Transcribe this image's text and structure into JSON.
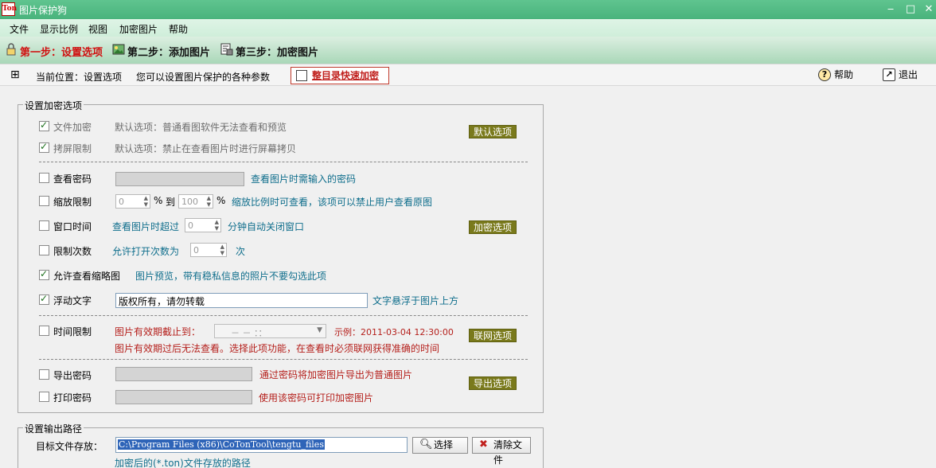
{
  "window": {
    "title": "图片保护狗",
    "icon_text": "Ton",
    "min": "‒",
    "max": "□",
    "close": "✕"
  },
  "menu": [
    "文件",
    "显示比例",
    "视图",
    "加密图片",
    "帮助"
  ],
  "steps": [
    {
      "label": "第一步：设置选项",
      "active": true
    },
    {
      "label": "第二步：添加图片",
      "active": false
    },
    {
      "label": "第三步：加密图片",
      "active": false
    }
  ],
  "location": {
    "expand": "⊞",
    "current": "当前位置：设置选项",
    "desc": "您可以设置图片保护的各种参数",
    "quick_encrypt": "整目录快速加密",
    "help": "帮助",
    "exit": "退出"
  },
  "encrypt_group": {
    "legend": "设置加密选项",
    "default_section": {
      "button": "默认选项",
      "items": [
        {
          "label": "文件加密",
          "checked": true,
          "desc": "默认选项：普通看图软件无法查看和预览"
        },
        {
          "label": "拷屏限制",
          "checked": true,
          "desc": "默认选项：禁止在查看图片时进行屏幕拷贝"
        }
      ]
    },
    "encrypt_section": {
      "button": "加密选项",
      "view_password": {
        "label": "查看密码",
        "checked": false,
        "desc": "查看图片时需输入的密码"
      },
      "zoom_limit": {
        "label": "缩放限制",
        "checked": false,
        "from": "0",
        "percent1": "%",
        "to": "到",
        "to_value": "100",
        "percent2": "%",
        "desc": "缩放比例时可查看，该项可以禁止用户查看原图"
      },
      "window_time": {
        "label": "窗口时间",
        "checked": false,
        "prefix": "查看图片时超过",
        "value": "0",
        "desc": "分钟自动关闭窗口"
      },
      "open_limit": {
        "label": "限制次数",
        "checked": false,
        "prefix": "允许打开次数为",
        "value": "0",
        "unit": "次"
      },
      "thumbnail": {
        "label": "允许查看缩略图",
        "checked": true,
        "desc": "图片预览，带有稳私信息的照片不要勾选此项"
      },
      "float_text": {
        "label": "浮动文字",
        "checked": true,
        "value": "版权所有，请勿转载",
        "desc": "文字悬浮于图片上方"
      }
    },
    "network_section": {
      "button": "联网选项",
      "time_limit": {
        "label": "时间限制",
        "checked": false,
        "prefix": "图片有效期截止到：",
        "date_value": "－ －   ：：",
        "example": "示例：2011-03-04 12:30:00",
        "note": "图片有效期过后无法查看。选择此项功能，在查看时必须联网获得准确的时间"
      }
    },
    "export_section": {
      "button": "导出选项",
      "export_password": {
        "label": "导出密码",
        "checked": false,
        "desc": "通过密码将加密图片导出为普通图片"
      },
      "print_password": {
        "label": "打印密码",
        "checked": false,
        "desc": "使用该密码可打印加密图片"
      }
    }
  },
  "output_group": {
    "legend": "设置输出路径",
    "target_label": "目标文件存放：",
    "path": "C:\\Program Files (x86)\\CoTonTool\\tengtu_files",
    "select_button": "选择",
    "clear_button": "清除文件",
    "hint": "加密后的(*.ton)文件存放的路径"
  },
  "colors": {
    "title_bar": "#49b37c",
    "active_step": "#d01010",
    "hint_text": "#0f6e8c",
    "warn_text": "#b5201c",
    "option_button": "#7a7a1c"
  },
  "icons": [
    "app-icon",
    "lock-icon",
    "picture-icon",
    "encrypt-icon",
    "folder-lock-icon",
    "help-icon",
    "exit-icon",
    "search-icon",
    "delete-icon"
  ]
}
